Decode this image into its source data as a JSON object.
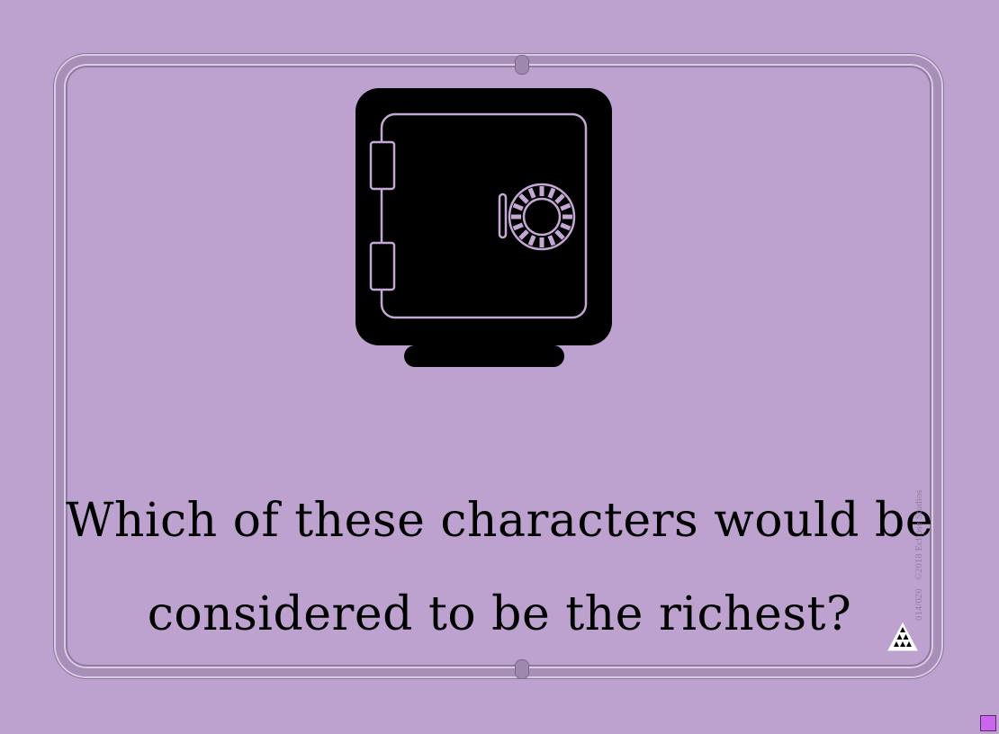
{
  "card": {
    "icon": "safe-icon",
    "question": "Which of these characters would be considered to be the richest?",
    "card_number": "014/020",
    "copyright": "©2018 Eclipse Studios",
    "publisher_logo": "triangle-logo-icon"
  },
  "colors": {
    "background": "#bda2d0",
    "frame": "#a88fb8",
    "icon": "#000000",
    "corner_marker": "#cc66ee"
  }
}
